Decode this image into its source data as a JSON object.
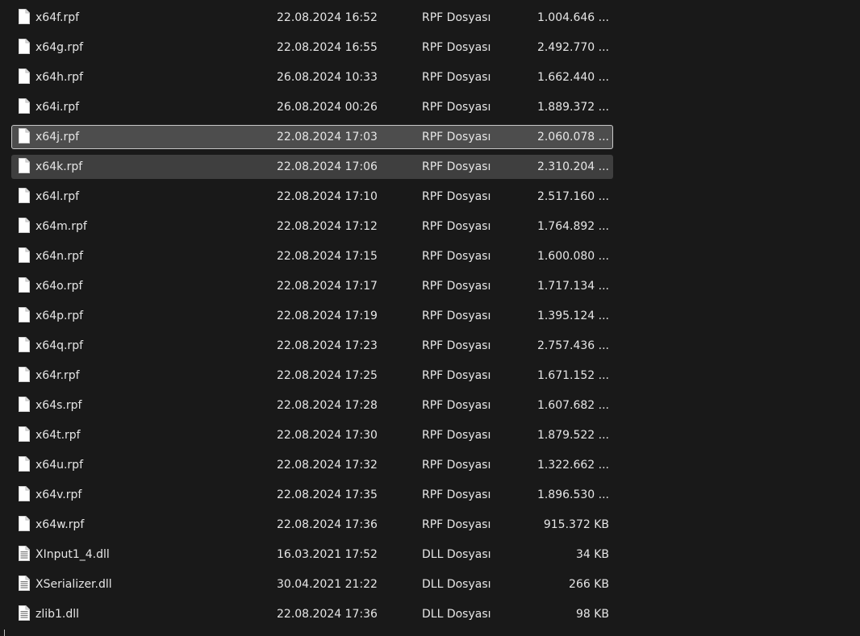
{
  "files": [
    {
      "name": "x64f.rpf",
      "date": "22.08.2024 16:52",
      "type": "RPF Dosyası",
      "size": "1.004.646 ...",
      "icon": "file-icon",
      "state": ""
    },
    {
      "name": "x64g.rpf",
      "date": "22.08.2024 16:55",
      "type": "RPF Dosyası",
      "size": "2.492.770 ...",
      "icon": "file-icon",
      "state": ""
    },
    {
      "name": "x64h.rpf",
      "date": "26.08.2024 10:33",
      "type": "RPF Dosyası",
      "size": "1.662.440 ...",
      "icon": "file-icon",
      "state": ""
    },
    {
      "name": "x64i.rpf",
      "date": "26.08.2024 00:26",
      "type": "RPF Dosyası",
      "size": "1.889.372 ...",
      "icon": "file-icon",
      "state": ""
    },
    {
      "name": "x64j.rpf",
      "date": "22.08.2024 17:03",
      "type": "RPF Dosyası",
      "size": "2.060.078 ...",
      "icon": "file-icon",
      "state": "focused"
    },
    {
      "name": "x64k.rpf",
      "date": "22.08.2024 17:06",
      "type": "RPF Dosyası",
      "size": "2.310.204 ...",
      "icon": "file-icon",
      "state": "selected"
    },
    {
      "name": "x64l.rpf",
      "date": "22.08.2024 17:10",
      "type": "RPF Dosyası",
      "size": "2.517.160 ...",
      "icon": "file-icon",
      "state": ""
    },
    {
      "name": "x64m.rpf",
      "date": "22.08.2024 17:12",
      "type": "RPF Dosyası",
      "size": "1.764.892 ...",
      "icon": "file-icon",
      "state": ""
    },
    {
      "name": "x64n.rpf",
      "date": "22.08.2024 17:15",
      "type": "RPF Dosyası",
      "size": "1.600.080 ...",
      "icon": "file-icon",
      "state": ""
    },
    {
      "name": "x64o.rpf",
      "date": "22.08.2024 17:17",
      "type": "RPF Dosyası",
      "size": "1.717.134 ...",
      "icon": "file-icon",
      "state": ""
    },
    {
      "name": "x64p.rpf",
      "date": "22.08.2024 17:19",
      "type": "RPF Dosyası",
      "size": "1.395.124 ...",
      "icon": "file-icon",
      "state": ""
    },
    {
      "name": "x64q.rpf",
      "date": "22.08.2024 17:23",
      "type": "RPF Dosyası",
      "size": "2.757.436 ...",
      "icon": "file-icon",
      "state": ""
    },
    {
      "name": "x64r.rpf",
      "date": "22.08.2024 17:25",
      "type": "RPF Dosyası",
      "size": "1.671.152 ...",
      "icon": "file-icon",
      "state": ""
    },
    {
      "name": "x64s.rpf",
      "date": "22.08.2024 17:28",
      "type": "RPF Dosyası",
      "size": "1.607.682 ...",
      "icon": "file-icon",
      "state": ""
    },
    {
      "name": "x64t.rpf",
      "date": "22.08.2024 17:30",
      "type": "RPF Dosyası",
      "size": "1.879.522 ...",
      "icon": "file-icon",
      "state": ""
    },
    {
      "name": "x64u.rpf",
      "date": "22.08.2024 17:32",
      "type": "RPF Dosyası",
      "size": "1.322.662 ...",
      "icon": "file-icon",
      "state": ""
    },
    {
      "name": "x64v.rpf",
      "date": "22.08.2024 17:35",
      "type": "RPF Dosyası",
      "size": "1.896.530 ...",
      "icon": "file-icon",
      "state": ""
    },
    {
      "name": "x64w.rpf",
      "date": "22.08.2024 17:36",
      "type": "RPF Dosyası",
      "size": "915.372 KB",
      "icon": "file-icon",
      "state": ""
    },
    {
      "name": "XInput1_4.dll",
      "date": "16.03.2021 17:52",
      "type": "DLL Dosyası",
      "size": "34 KB",
      "icon": "dll-file-icon",
      "state": ""
    },
    {
      "name": "XSerializer.dll",
      "date": "30.04.2021 21:22",
      "type": "DLL Dosyası",
      "size": "266 KB",
      "icon": "dll-file-icon",
      "state": ""
    },
    {
      "name": "zlib1.dll",
      "date": "22.08.2024 17:36",
      "type": "DLL Dosyası",
      "size": "98 KB",
      "icon": "dll-file-icon",
      "state": ""
    }
  ],
  "colors": {
    "background": "#191919",
    "text": "#e6e6e6",
    "focused_row": "#4d4d4d",
    "selected_row": "#3f3f3f"
  }
}
